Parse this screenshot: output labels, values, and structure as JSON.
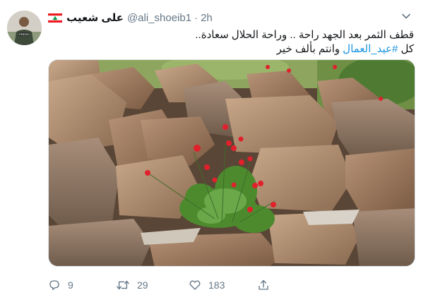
{
  "author": {
    "name": "على شعيب",
    "handle": "@ali_shoeib1",
    "separator": "·",
    "time": "2h",
    "avatar_badge": "PRESS"
  },
  "tweet": {
    "line1": "قطف الثمر بعد الجهد راحة .. وراحة الحلال سعادة..",
    "line2_pre": "كل ",
    "hashtag": "#عيد_العمال",
    "line2_post": " وانتم بألف خير"
  },
  "actions": {
    "replies": "9",
    "retweets": "29",
    "likes": "183"
  },
  "icons": [
    "lebanon-flag-icon",
    "chevron-down-icon",
    "reply-icon",
    "retweet-icon",
    "like-icon",
    "share-icon"
  ],
  "colors": {
    "hashtag": "#1b95e0",
    "muted": "#657786",
    "text": "#14171a",
    "flag_red": "#ed1c24",
    "flag_green": "#00a651"
  }
}
